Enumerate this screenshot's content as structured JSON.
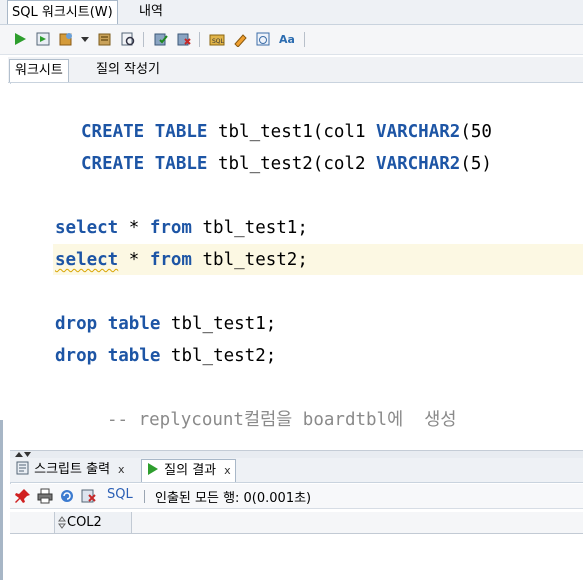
{
  "top_tabs": {
    "worksheet": "SQL 워크시트(W)",
    "history": "내역"
  },
  "subtabs": {
    "worksheet": "워크시트",
    "query_builder": "질의 작성기"
  },
  "editor": {
    "lines": [
      {
        "kw1": "CREATE",
        "kw2": "TABLE",
        "rest": " tbl_test1(col1 ",
        "kw3": "VARCHAR2",
        "tail": "(50"
      },
      {
        "kw1": "CREATE",
        "kw2": "TABLE",
        "rest": " tbl_test2(col2 ",
        "kw3": "VARCHAR2",
        "tail": "(5)"
      },
      {
        "kw1": "select",
        "mid": " * ",
        "kw2": "from",
        "rest": " tbl_test1;"
      },
      {
        "kw1": "select",
        "mid": " * ",
        "kw2": "from",
        "rest": " tbl_test2;"
      },
      {
        "kw1": "drop",
        "kw2": "table",
        "rest": " tbl_test1;"
      },
      {
        "kw1": "drop",
        "kw2": "table",
        "rest": " tbl_test2;"
      }
    ],
    "comment": "-- replycount컬럼을 boardtbl에  생성"
  },
  "result_tabs": {
    "script_output": "스크립트 출력",
    "query_result": "질의 결과",
    "close": "x"
  },
  "result_toolbar": {
    "sql_label": "SQL",
    "status": "인출된 모든 행: 0(0.001초)"
  },
  "grid": {
    "columns": [
      "COL2"
    ]
  },
  "colors": {
    "keyword": "#1d55a5",
    "comment": "#8a8a8a",
    "current_line": "#fcf8e3"
  }
}
